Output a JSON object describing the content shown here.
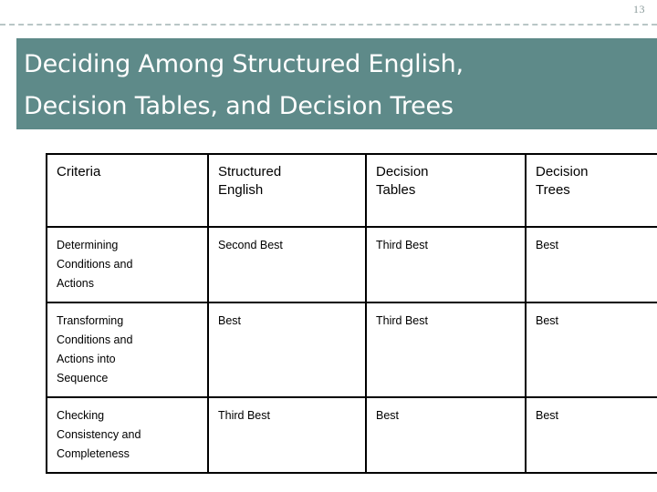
{
  "slide": {
    "page_number": "13",
    "title": "Deciding Among Structured English,\nDecision Tables, and Decision Trees",
    "accent_color": "#5e8a89",
    "rule_color": "#b9c6c6",
    "title_text_color": "#ffffff",
    "table_border_color": "#000000"
  },
  "table": {
    "headers": [
      "Criteria",
      "Structured\nEnglish",
      "Decision\nTables",
      "Decision\nTrees"
    ],
    "rows": [
      {
        "criteria": "Determining\nConditions and\nActions",
        "structured_english": "Second Best",
        "decision_tables": "Third Best",
        "decision_trees": "Best"
      },
      {
        "criteria": "Transforming\nConditions and\nActions into\nSequence",
        "structured_english": "Best",
        "decision_tables": "Third Best",
        "decision_trees": "Best"
      },
      {
        "criteria": "Checking\nConsistency and\nCompleteness",
        "structured_english": "Third Best",
        "decision_tables": "Best",
        "decision_trees": "Best"
      }
    ]
  }
}
